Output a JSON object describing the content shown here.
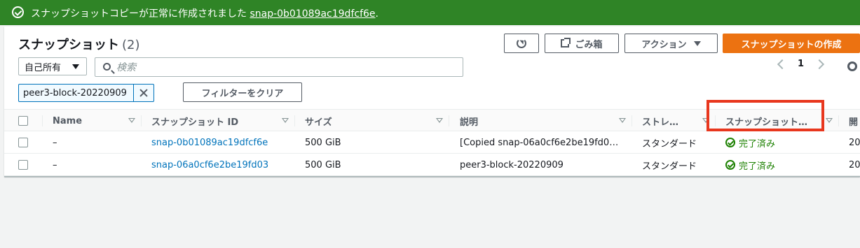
{
  "flash": {
    "message": "スナップショットコピーが正常に作成されました",
    "link": "snap-0b01089ac19dfcf6e",
    "suffix": "."
  },
  "header": {
    "title": "スナップショット",
    "count": "(2)",
    "trash_label": "ごみ箱",
    "actions_label": "アクション",
    "create_label": "スナップショットの作成"
  },
  "filters": {
    "owner": "自己所有",
    "search_placeholder": "検索",
    "token": "peer3-block-20220909",
    "clear_label": "フィルターをクリア"
  },
  "pagination": {
    "page": "1"
  },
  "table": {
    "columns": [
      "Name",
      "スナップショット ID",
      "サイズ",
      "説明",
      "ストレ…",
      "スナップショット…",
      "開"
    ],
    "rows": [
      {
        "name": "–",
        "id": "snap-0b01089ac19dfcf6e",
        "size": "500 GiB",
        "description": "[Copied snap-06a0cf6e2be19fd0…",
        "storage": "スタンダード",
        "status": "完了済み",
        "started": "20"
      },
      {
        "name": "–",
        "id": "snap-06a0cf6e2be19fd03",
        "size": "500 GiB",
        "description": "peer3-block-20220909",
        "storage": "スタンダード",
        "status": "完了済み",
        "started": "20"
      }
    ]
  },
  "colors": {
    "flash_bg": "#2f8426",
    "primary": "#ec7211",
    "link": "#0073bb",
    "success": "#1d8102",
    "highlight": "#e8371e"
  }
}
